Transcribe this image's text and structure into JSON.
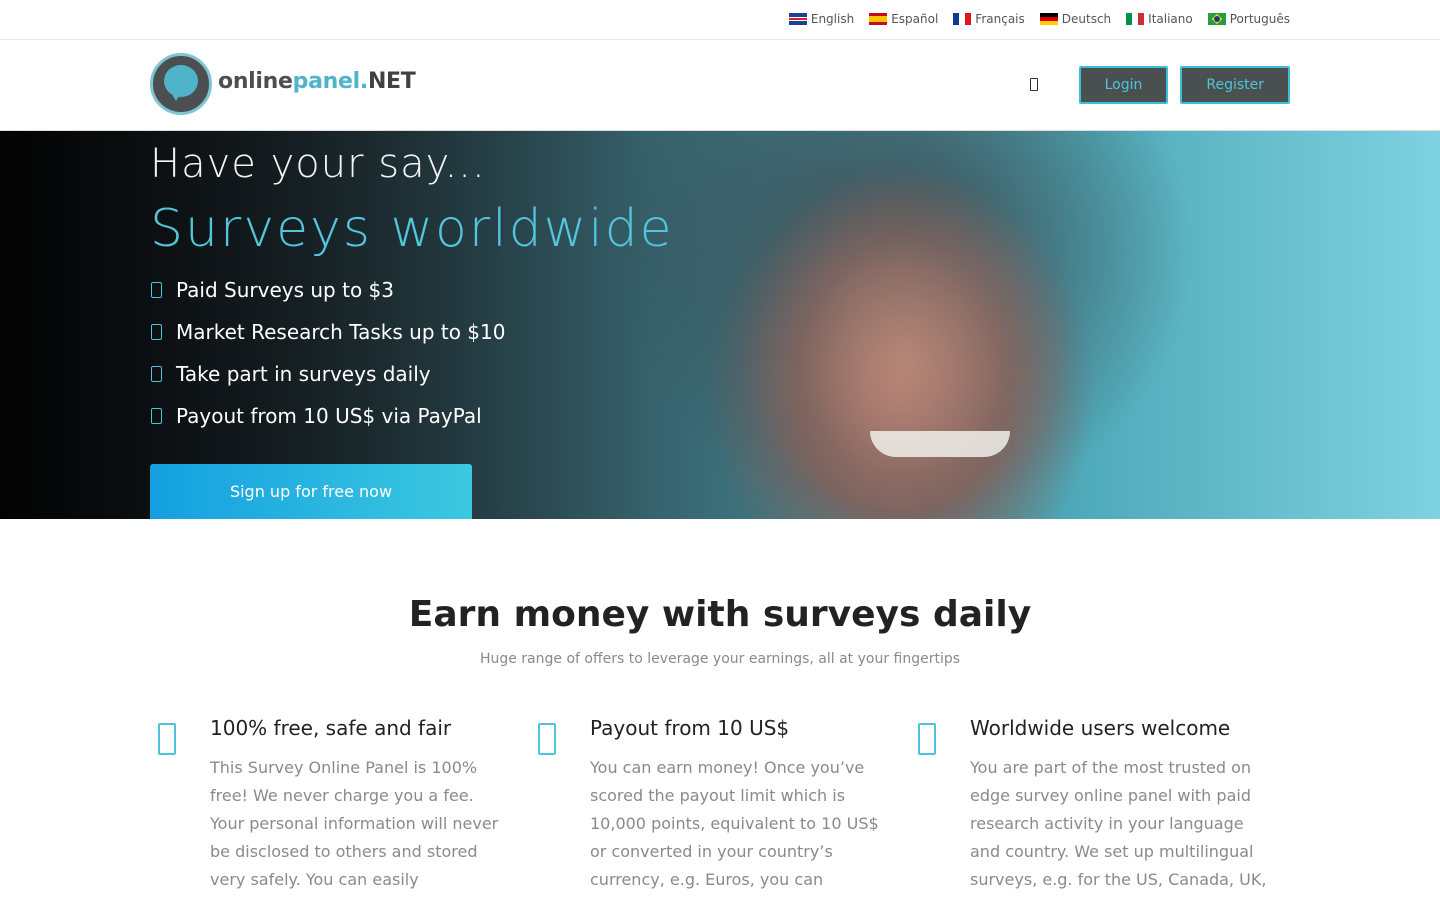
{
  "languages": [
    {
      "label": "English",
      "flag": "en"
    },
    {
      "label": "Español",
      "flag": "es"
    },
    {
      "label": "Français",
      "flag": "fr"
    },
    {
      "label": "Deutsch",
      "flag": "de"
    },
    {
      "label": "Italiano",
      "flag": "it"
    },
    {
      "label": "Português",
      "flag": "pt"
    }
  ],
  "brand": {
    "part1": "online",
    "part2": "panel.",
    "part3": "NET",
    "accent": "#4fb3c9"
  },
  "header": {
    "login": "Login",
    "register": "Register",
    "user_icon": "user-icon"
  },
  "hero": {
    "kicker": "Have your say...",
    "title": "Surveys worldwide",
    "benefits": [
      "Paid Surveys up to $3",
      "Market Research Tasks up to $10",
      "Take part in surveys daily",
      "Payout from 10 US$ via PayPal"
    ],
    "cta": "Sign up for free now"
  },
  "section": {
    "title": "Earn money with surveys daily",
    "subtitle": "Huge range of offers to leverage your earnings, all at your fingertips",
    "features": [
      {
        "title": "100% free, safe and fair",
        "text": "This Survey Online Panel is 100% free! We never charge you a fee. Your personal information will never be disclosed to others and stored very safely. You can easily",
        "icon": "shield-icon"
      },
      {
        "title": "Payout from 10 US$",
        "text": "You can earn money! Once you’ve scored the payout limit which is 10,000 points, equivalent to 10 US$ or converted in your country’s currency, e.g. Euros, you can",
        "icon": "money-icon"
      },
      {
        "title": "Worldwide users welcome",
        "text": "You are part of the most trusted on edge survey online panel with paid research activity in your language and country. We set up multilingual surveys, e.g. for the US, Canada, UK,",
        "icon": "globe-icon"
      }
    ]
  }
}
